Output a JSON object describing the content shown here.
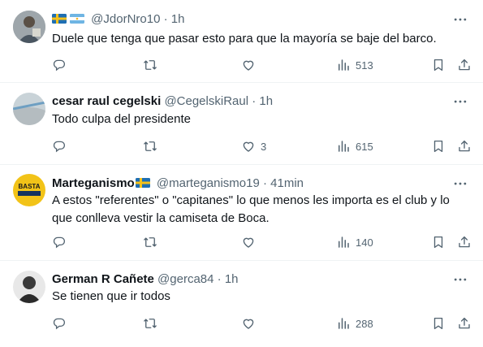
{
  "tweets": [
    {
      "name": "",
      "handle": "@JdorNro10",
      "dot": "·",
      "time": "1h",
      "text": "Duele que tenga que pasar esto para que la mayoría se baje del barco.",
      "flags": [
        "sweden",
        "argentina"
      ],
      "replies": "",
      "retweets": "",
      "likes": "",
      "views": "513"
    },
    {
      "name": "cesar raul cegelski",
      "handle": "@CegelskiRaul",
      "dot": "·",
      "time": "1h",
      "text": "Todo culpa del presidente",
      "replies": "",
      "retweets": "",
      "likes": "3",
      "views": "615"
    },
    {
      "name": "Marteganismo",
      "handle": "@marteganismo19",
      "dot": "·",
      "time": "41min",
      "text_line1": "A estos \"referentes\" o \"capitanes\" lo que menos les importa es el club y lo",
      "text_line2": "que conlleva vestir la camiseta de Boca.",
      "avatar_text": "BASTA",
      "flags": [
        "sweden"
      ],
      "replies": "",
      "retweets": "",
      "likes": "",
      "views": "140"
    },
    {
      "name": "German R Cañete",
      "handle": "@gerca84",
      "dot": "·",
      "time": "1h",
      "text": "Se tienen que ir todos",
      "replies": "",
      "retweets": "",
      "likes": "",
      "views": "288"
    }
  ],
  "icons": {
    "reply": "reply-icon",
    "retweet": "retweet-icon",
    "like": "heart-icon",
    "views": "views-icon",
    "bookmark": "bookmark-icon",
    "share": "share-icon",
    "more": "more-icon"
  },
  "colors": {
    "text": "#0f1419",
    "secondary": "#536471",
    "divider": "#eff3f4"
  }
}
